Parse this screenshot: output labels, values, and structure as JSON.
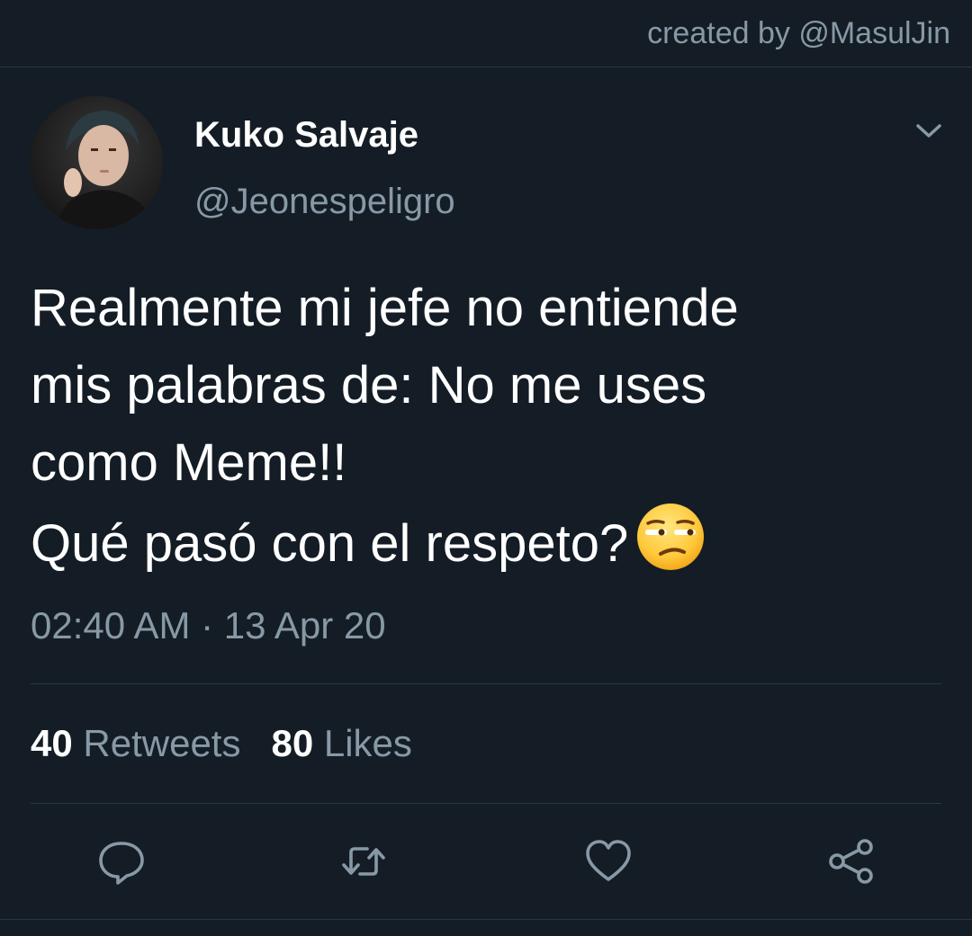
{
  "header": {
    "credit": "created by @MasulJin"
  },
  "author": {
    "display_name": "Kuko Salvaje",
    "handle": "@Jeonespeligro",
    "avatar_icon": "profile-photo"
  },
  "tweet": {
    "lines": [
      "Realmente mi jefe no entiende",
      "mis palabras de: No me uses",
      "como Meme!!",
      "Qué pasó con el respeto?"
    ],
    "emoji": "unamused-face-emoji",
    "timestamp": "02:40 AM · 13 Apr 20"
  },
  "stats": {
    "retweets_count": "40",
    "retweets_label": "Retweets",
    "likes_count": "80",
    "likes_label": "Likes"
  },
  "actions": {
    "reply_icon": "reply-icon",
    "retweet_icon": "retweet-icon",
    "like_icon": "heart-icon",
    "share_icon": "share-icon"
  },
  "colors": {
    "background": "#141d26",
    "secondary_text": "#8899a6",
    "divider": "#2b3743"
  }
}
